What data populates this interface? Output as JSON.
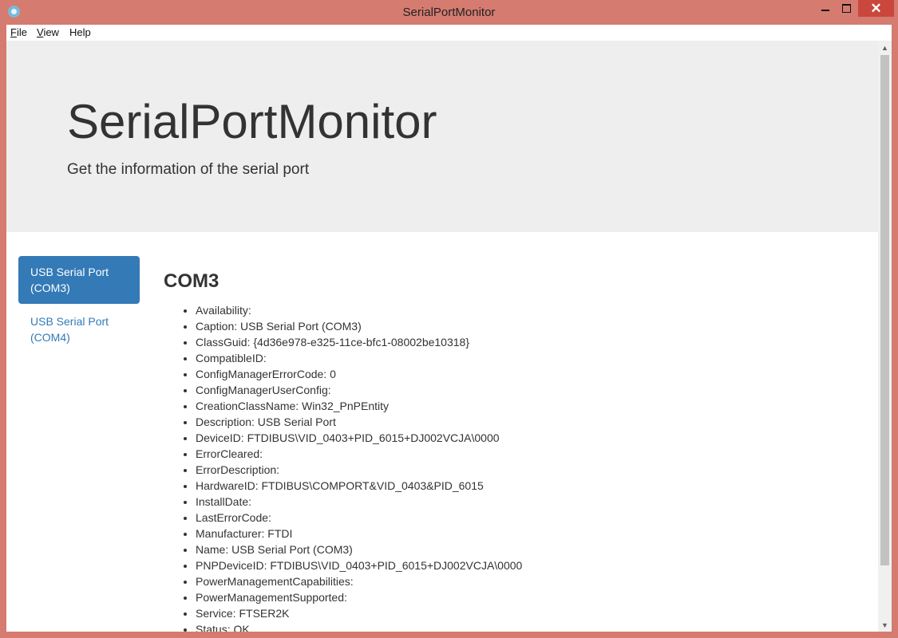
{
  "window": {
    "title": "SerialPortMonitor",
    "minimize_glyph": "—",
    "close_glyph": "✕"
  },
  "menu": [
    {
      "label": "File",
      "mnemonic": "F",
      "rest": "ile"
    },
    {
      "label": "View",
      "mnemonic": "V",
      "rest": "iew"
    },
    {
      "label": "Help",
      "mnemonic": "",
      "rest": "Help"
    }
  ],
  "hero": {
    "title": "SerialPortMonitor",
    "subtitle": "Get the information of the serial port"
  },
  "sidebar": {
    "items": [
      {
        "label_line1": "USB Serial Port",
        "label_line2": "(COM3)",
        "active": true
      },
      {
        "label_line1": "USB Serial Port",
        "label_line2": "(COM4)",
        "active": false
      }
    ]
  },
  "port": {
    "name": "COM3",
    "properties": [
      "Availability:",
      "Caption: USB Serial Port (COM3)",
      "ClassGuid: {4d36e978-e325-11ce-bfc1-08002be10318}",
      "CompatibleID:",
      "ConfigManagerErrorCode: 0",
      "ConfigManagerUserConfig:",
      "CreationClassName: Win32_PnPEntity",
      "Description: USB Serial Port",
      "DeviceID: FTDIBUS\\VID_0403+PID_6015+DJ002VCJA\\0000",
      "ErrorCleared:",
      "ErrorDescription:",
      "HardwareID: FTDIBUS\\COMPORT&VID_0403&PID_6015",
      "InstallDate:",
      "LastErrorCode:",
      "Manufacturer: FTDI",
      "Name: USB Serial Port (COM3)",
      "PNPDeviceID: FTDIBUS\\VID_0403+PID_6015+DJ002VCJA\\0000",
      "PowerManagementCapabilities:",
      "PowerManagementSupported:",
      "Service: FTSER2K",
      "Status: OK"
    ]
  },
  "scrollbar": {
    "up_icon": "▲",
    "down_icon": "▼"
  },
  "colors": {
    "window_frame": "#d57b70",
    "accent": "#337ab7",
    "hero_background": "#eeeeee"
  }
}
